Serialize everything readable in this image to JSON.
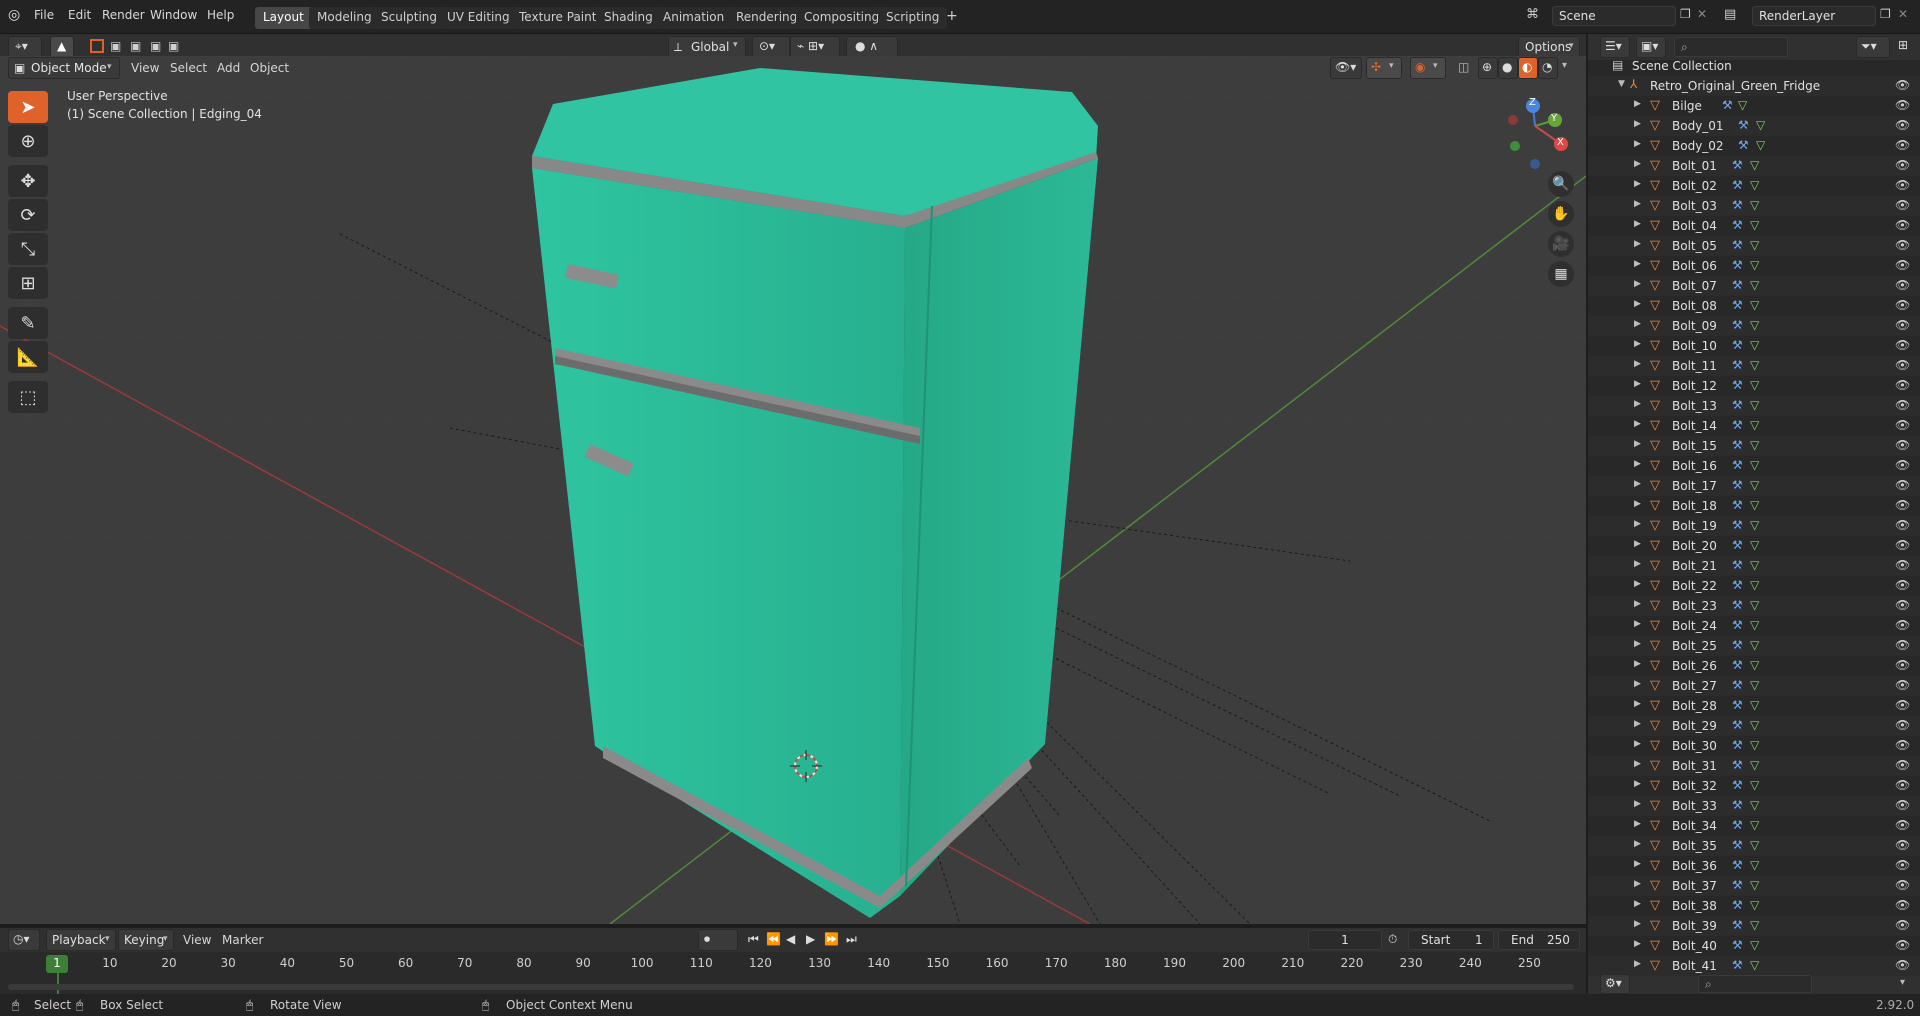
{
  "app": {
    "menu": [
      "File",
      "Edit",
      "Render",
      "Window",
      "Help"
    ],
    "workspaces": [
      "Layout",
      "Modeling",
      "Sculpting",
      "UV Editing",
      "Texture Paint",
      "Shading",
      "Animation",
      "Rendering",
      "Compositing",
      "Scripting"
    ],
    "add_workspace": "+",
    "scene_name": "Scene",
    "render_layer": "RenderLayer"
  },
  "viewport_header": {
    "mode": "Object Mode",
    "menus": [
      "View",
      "Select",
      "Add",
      "Object"
    ],
    "transform_orientation": "Global",
    "options_label": "Options"
  },
  "viewport": {
    "perspective": "User Perspective",
    "context": "(1) Scene Collection | Edging_04",
    "fridge_color": "#2bb796",
    "trim_color": "#8a8a8a",
    "gizmo": {
      "x": "X",
      "y": "Y",
      "z": "Z"
    }
  },
  "outliner": {
    "root": "Scene Collection",
    "collection": "Retro_Original_Green_Fridge",
    "items": [
      "Bilge",
      "Body_01",
      "Body_02",
      "Bolt_01",
      "Bolt_02",
      "Bolt_03",
      "Bolt_04",
      "Bolt_05",
      "Bolt_06",
      "Bolt_07",
      "Bolt_08",
      "Bolt_09",
      "Bolt_10",
      "Bolt_11",
      "Bolt_12",
      "Bolt_13",
      "Bolt_14",
      "Bolt_15",
      "Bolt_16",
      "Bolt_17",
      "Bolt_18",
      "Bolt_19",
      "Bolt_20",
      "Bolt_21",
      "Bolt_22",
      "Bolt_23",
      "Bolt_24",
      "Bolt_25",
      "Bolt_26",
      "Bolt_27",
      "Bolt_28",
      "Bolt_29",
      "Bolt_30",
      "Bolt_31",
      "Bolt_32",
      "Bolt_33",
      "Bolt_34",
      "Bolt_35",
      "Bolt_36",
      "Bolt_37",
      "Bolt_38",
      "Bolt_39",
      "Bolt_40",
      "Bolt_41"
    ]
  },
  "timeline": {
    "menus": [
      "Playback",
      "Keying",
      "View",
      "Marker"
    ],
    "current_frame": "1",
    "start_label": "Start",
    "start": "1",
    "end_label": "End",
    "end": "250",
    "ticks": [
      "10",
      "20",
      "30",
      "40",
      "50",
      "60",
      "70",
      "80",
      "90",
      "100",
      "110",
      "120",
      "130",
      "140",
      "150",
      "160",
      "170",
      "180",
      "190",
      "200",
      "210",
      "220",
      "230",
      "240",
      "250"
    ],
    "playhead": "1"
  },
  "statusbar": {
    "select": "Select",
    "box_select": "Box Select",
    "rotate_view": "Rotate View",
    "context_menu": "Object Context Menu",
    "version": "2.92.0"
  }
}
